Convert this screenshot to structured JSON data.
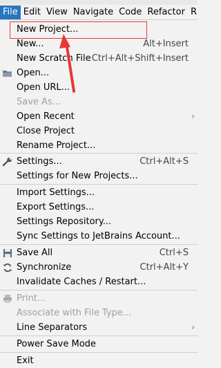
{
  "menubar": {
    "items": [
      {
        "label": "File"
      },
      {
        "label": "Edit"
      },
      {
        "label": "View"
      },
      {
        "label": "Navigate"
      },
      {
        "label": "Code"
      },
      {
        "label": "Refactor"
      },
      {
        "label": "R"
      }
    ]
  },
  "file_menu": {
    "items": [
      {
        "label": "New Project...",
        "shortcut": ""
      },
      {
        "label": "New...",
        "shortcut": "Alt+Insert"
      },
      {
        "label": "New Scratch File",
        "shortcut": "Ctrl+Alt+Shift+Insert"
      },
      {
        "label": "Open...",
        "icon": "folder-icon"
      },
      {
        "label": "Open URL..."
      },
      {
        "label": "Save As...",
        "disabled": true
      },
      {
        "label": "Open Recent",
        "submenu": true
      },
      {
        "label": "Close Project"
      },
      {
        "label": "Rename Project..."
      },
      {
        "label": "Settings...",
        "shortcut": "Ctrl+Alt+S",
        "icon": "wrench-icon"
      },
      {
        "label": "Settings for New Projects..."
      },
      {
        "label": "Import Settings..."
      },
      {
        "label": "Export Settings..."
      },
      {
        "label": "Settings Repository..."
      },
      {
        "label": "Sync Settings to JetBrains Account..."
      },
      {
        "label": "Save All",
        "shortcut": "Ctrl+S",
        "icon": "save-icon"
      },
      {
        "label": "Synchronize",
        "shortcut": "Ctrl+Alt+Y",
        "icon": "sync-icon"
      },
      {
        "label": "Invalidate Caches / Restart..."
      },
      {
        "label": "Print...",
        "disabled": true,
        "icon": "print-icon"
      },
      {
        "label": "Associate with File Type...",
        "disabled": true
      },
      {
        "label": "Line Separators",
        "submenu": true
      },
      {
        "label": "Power Save Mode"
      },
      {
        "label": "Exit"
      }
    ],
    "submenu_arrow": "›"
  },
  "colors": {
    "accent": "#2675bf",
    "annotation_red": "#e53935"
  }
}
